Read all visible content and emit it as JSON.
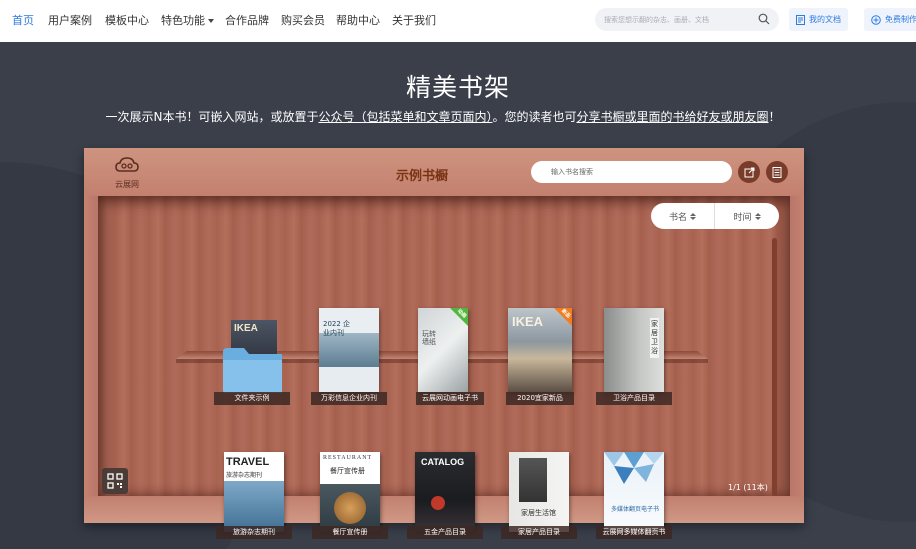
{
  "nav": {
    "items": [
      "首页",
      "用户案例",
      "模板中心",
      "特色功能",
      "合作品牌",
      "购买会员",
      "帮助中心",
      "关于我们"
    ],
    "search_placeholder": "搜索您想示翻的杂志、画册、文档",
    "my_docs": "我的文档",
    "free_create": "免费制作"
  },
  "hero": {
    "title": "精美书架",
    "sub_a": "一次展示N本书！可嵌入网站，或放置于",
    "sub_b": "公众号（包括菜单和文章页面内）",
    "sub_c": "。您的读者也可",
    "sub_d": "分享书橱或里面的书给好友或朋友圈",
    "sub_e": "！"
  },
  "shelf": {
    "logo_text": "云展网",
    "title": "示例书橱",
    "search_placeholder": "输入书名搜索",
    "sort_name": "书名",
    "sort_time": "时间",
    "page_info": "1/1 (11本)",
    "row1": [
      {
        "label": "文件夹示例",
        "cover_text": "IKEA"
      },
      {
        "label": "万彩信息企业内刊",
        "cover_text": "2022 企业内刊"
      },
      {
        "label": "云展网动画电子书",
        "cover_text": "玩转墙纸",
        "ribbon": "动画"
      },
      {
        "label": "2020宜家新品",
        "cover_text": "IKEA",
        "ribbon": "新品"
      },
      {
        "label": "卫浴产品目录",
        "cover_text": "家居卫浴"
      }
    ],
    "row2": [
      {
        "label": "旅游杂志期刊",
        "cover_text": "TRAVEL",
        "cover_sub": "旅游杂志期刊"
      },
      {
        "label": "餐厅宣传册",
        "cover_text": "RESTAURANT",
        "cover_sub": "餐厅宣传册"
      },
      {
        "label": "五金产品目录",
        "cover_text": "CATALOG"
      },
      {
        "label": "家居产品目录",
        "cover_text": "家居生活馆"
      },
      {
        "label": "云展网多媒体翻页书",
        "cover_text": "多媒体翻页电子书"
      }
    ]
  },
  "colors": {
    "accent": "#2f7be0",
    "hero_bg": "#3a3f4a",
    "shelf_wood": "#b9766a",
    "shelf_title": "#7a3414"
  }
}
